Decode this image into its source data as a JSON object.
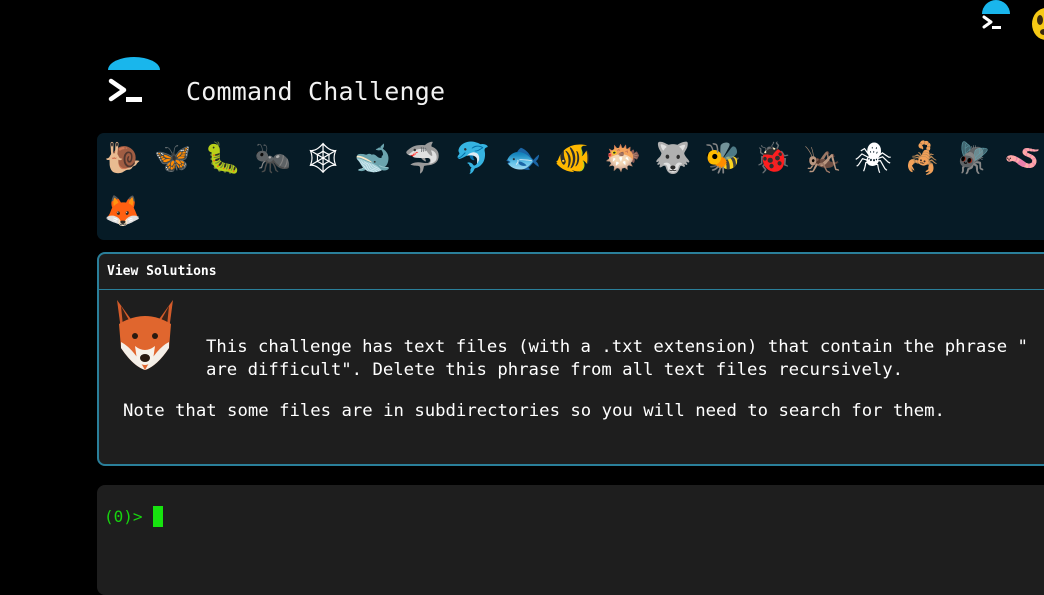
{
  "header": {
    "title": "Command Challenge",
    "logo_icon": "terminal-umbrella-logo",
    "accent_color": "#19b6ec"
  },
  "corner": {
    "logo_icon": "terminal-umbrella-logo",
    "face_icon": "yellow-face-emoji"
  },
  "emojis": [
    {
      "name": "snail",
      "glyph": "🐌"
    },
    {
      "name": "butterfly",
      "glyph": "🦋"
    },
    {
      "name": "caterpillar",
      "glyph": "🐛"
    },
    {
      "name": "ant",
      "glyph": "🐜"
    },
    {
      "name": "spider-web",
      "glyph": "🕸"
    },
    {
      "name": "whale",
      "glyph": "🐋"
    },
    {
      "name": "shark",
      "glyph": "🦈"
    },
    {
      "name": "dolphin",
      "glyph": "🐬"
    },
    {
      "name": "fish",
      "glyph": "🐟"
    },
    {
      "name": "tropical-fish",
      "glyph": "🐠"
    },
    {
      "name": "blowfish",
      "glyph": "🐡"
    },
    {
      "name": "wolf",
      "glyph": "🐺"
    },
    {
      "name": "bee",
      "glyph": "🐝"
    },
    {
      "name": "ladybug",
      "glyph": "🐞"
    },
    {
      "name": "cricket",
      "glyph": "🦗"
    },
    {
      "name": "spider",
      "glyph": "🕷"
    },
    {
      "name": "scorpion",
      "glyph": "🦂"
    },
    {
      "name": "fly",
      "glyph": "🪰"
    },
    {
      "name": "worm",
      "glyph": "🪱"
    },
    {
      "name": "fox",
      "glyph": "🦊"
    }
  ],
  "solutions": {
    "header_label": "View Solutions",
    "avatar_icon": "fox-icon",
    "text_line1": "This challenge has text files (with a .txt extension) that contain the phrase \"",
    "text_line2": "are difficult\". Delete this phrase from all text files recursively.",
    "note": "Note that some files are in subdirectories so you will need to search for them."
  },
  "terminal": {
    "prompt": "(0)>",
    "input_value": "",
    "prompt_color": "#17d40f"
  }
}
